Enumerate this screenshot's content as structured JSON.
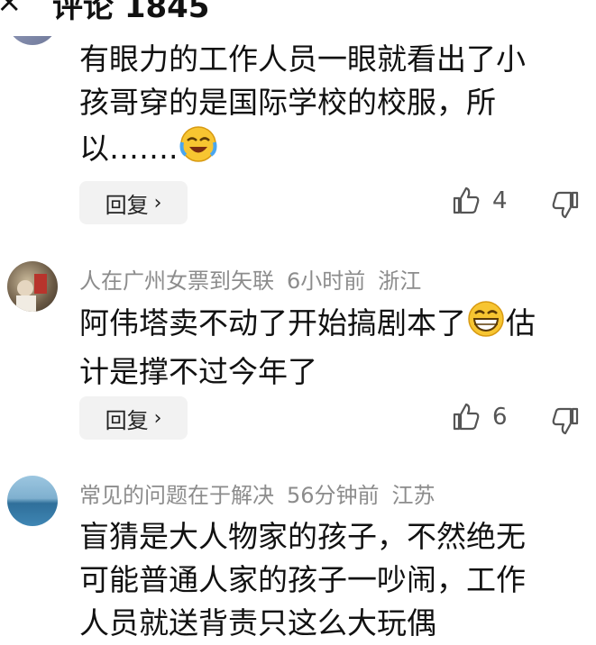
{
  "header": {
    "close_glyph": "×",
    "title": "评论 1845"
  },
  "comments": [
    {
      "avatar": "user-avatar-grey",
      "text_line1": "有眼力的工作人员一眼就看出了小",
      "text_line2": "孩哥穿的是国际学校的校服，所",
      "text_line3": "以…….",
      "emoji": "crying-laughing-emoji",
      "reply_label": "回复",
      "likes": "4"
    },
    {
      "avatar": "user-avatar-photo",
      "username": "人在广州女票到矢联",
      "time": "6小时前",
      "location": "浙江",
      "text_line1": "阿伟塔卖不动了开始搞剧本了",
      "text_line1_after": "估",
      "text_line2": "计是撑不过今年了",
      "emoji": "grinning-emoji",
      "reply_label": "回复",
      "likes": "6"
    },
    {
      "avatar": "user-avatar-sea",
      "username": "常见的问题在于解决",
      "time": "56分钟前",
      "location": "江苏",
      "text_line1": "盲猜是大人物家的孩子，不然绝无",
      "text_line2": "可能普通人家的孩子一吵闹，工作",
      "text_line3": "人员就送背责只这么大玩偶"
    }
  ],
  "colors": {
    "meta_text": "#8c8c8c",
    "reply_bg": "#f2f2f2",
    "text": "#111111"
  }
}
